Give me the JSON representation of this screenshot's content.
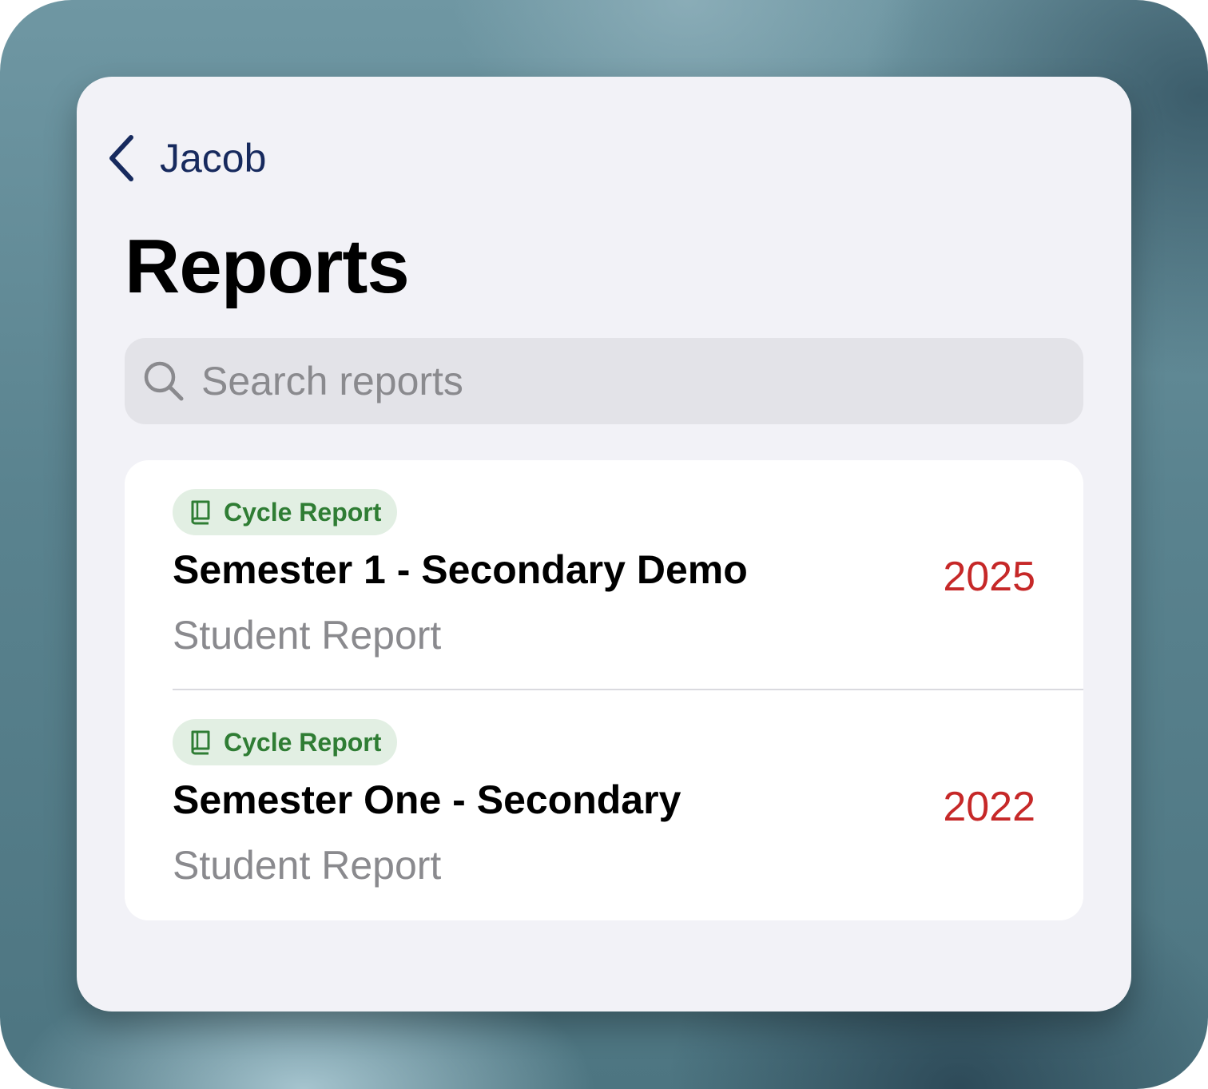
{
  "colors": {
    "accent_navy": "#172a5e",
    "badge_green": "#2f7d34",
    "badge_bg": "#e2efe3",
    "year_red": "#c62828",
    "secondary_text": "#8a8a8e"
  },
  "nav": {
    "back_label": "Jacob",
    "back_icon": "chevron-left-icon"
  },
  "page": {
    "title": "Reports"
  },
  "search": {
    "placeholder": "Search reports",
    "value": "",
    "icon": "search-icon"
  },
  "reports": [
    {
      "badge": "Cycle Report",
      "badge_icon": "book-icon",
      "title": "Semester 1 - Secondary Demo",
      "subtitle": "Student Report",
      "year": "2025"
    },
    {
      "badge": "Cycle Report",
      "badge_icon": "book-icon",
      "title": "Semester One - Secondary",
      "subtitle": "Student Report",
      "year": "2022"
    }
  ]
}
